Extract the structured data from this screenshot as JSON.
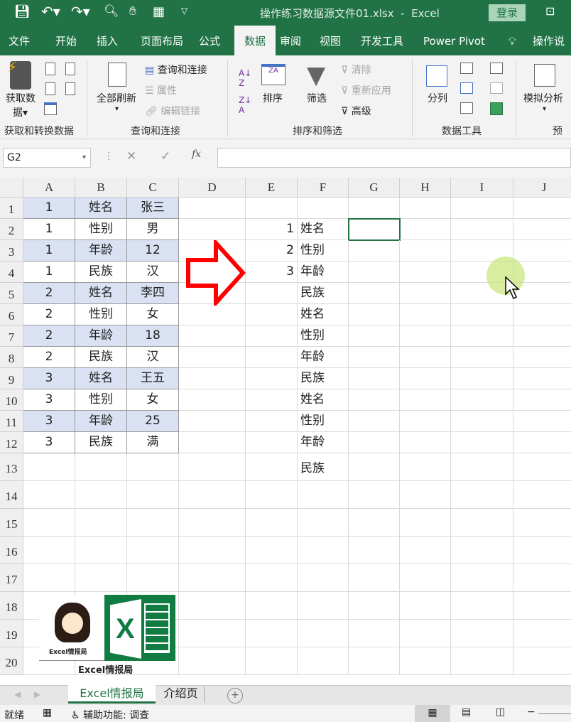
{
  "titlebar": {
    "filename": "操作练习数据源文件01.xlsx",
    "app": "Excel",
    "separator": "-",
    "login": "登录",
    "bg": "#217346"
  },
  "tabs": [
    "文件",
    "开始",
    "插入",
    "页面布局",
    "公式",
    "数据",
    "审阅",
    "视图",
    "开发工具",
    "Power Pivot",
    "操作说明"
  ],
  "active_tab": "数据",
  "ribbon": {
    "get_data": "获取数",
    "get_data2": "据",
    "group1": "获取和转换数据",
    "refresh_all": "全部刷新",
    "queries_connections": "查询和连接",
    "properties": "属性",
    "edit_links": "编辑链接",
    "group2": "查询和连接",
    "sort": "排序",
    "filter": "筛选",
    "clear": "清除",
    "reapply": "重新应用",
    "advanced": "高级",
    "group3": "排序和筛选",
    "split": "分列",
    "group4": "数据工具",
    "what_if": "模拟分析",
    "group5": "预测"
  },
  "formula_bar": {
    "name_box": "G2",
    "fx": "fx",
    "value": ""
  },
  "columns": [
    "A",
    "B",
    "C",
    "D",
    "E",
    "F",
    "G",
    "H",
    "I",
    "J"
  ],
  "rows": [
    "1",
    "2",
    "3",
    "4",
    "5",
    "6",
    "7",
    "8",
    "9",
    "10",
    "11",
    "12",
    "13",
    "14",
    "15",
    "16",
    "17",
    "18",
    "19",
    "20"
  ],
  "table": [
    [
      "1",
      "姓名",
      "张三"
    ],
    [
      "1",
      "性别",
      "男"
    ],
    [
      "1",
      "年龄",
      "12"
    ],
    [
      "1",
      "民族",
      "汉"
    ],
    [
      "2",
      "姓名",
      "李四"
    ],
    [
      "2",
      "性别",
      "女"
    ],
    [
      "2",
      "年龄",
      "18"
    ],
    [
      "2",
      "民族",
      "汉"
    ],
    [
      "3",
      "姓名",
      "王五"
    ],
    [
      "3",
      "性别",
      "女"
    ],
    [
      "3",
      "年龄",
      "25"
    ],
    [
      "3",
      "民族",
      "满"
    ]
  ],
  "col_e": [
    "",
    "1",
    "2",
    "3"
  ],
  "col_f": [
    "",
    "姓名",
    "性别",
    "年龄",
    "民族",
    "姓名",
    "性别",
    "年龄",
    "民族",
    "姓名",
    "性别",
    "年龄",
    "民族"
  ],
  "band_color": "#d9e1f2",
  "arrow_color": "#ff0000",
  "logo": {
    "text": "Excel情报局",
    "caption": "Excel情报局"
  },
  "sheet_tabs": [
    "Excel情报局",
    "介绍页"
  ],
  "active_sheet": "Excel情报局",
  "status": {
    "ready": "就绪",
    "accessibility": "辅助功能: 调查"
  }
}
